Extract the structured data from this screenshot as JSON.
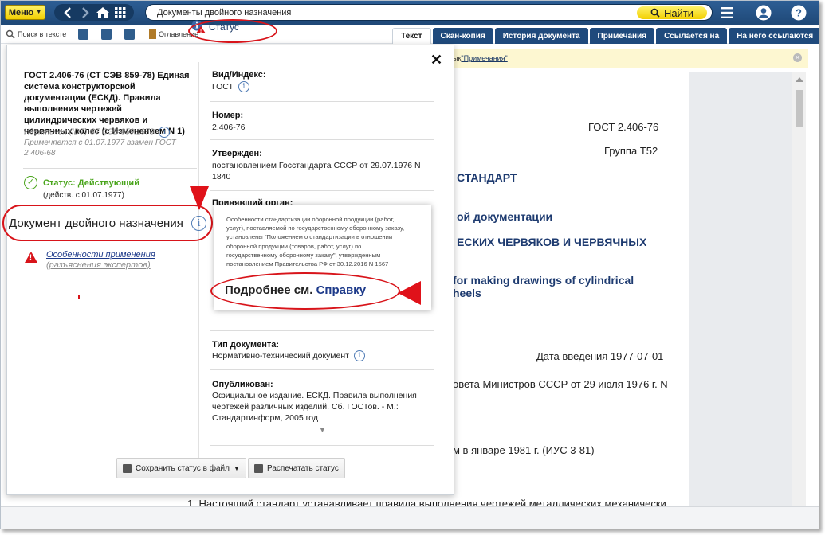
{
  "topbar": {
    "menu_label": "Меню",
    "search_value": "Документы двойного назначения",
    "find_label": "Найти"
  },
  "toolbar": {
    "search_in_text": "Поиск в тексте",
    "contents": "Оглавление",
    "status": "Статус"
  },
  "tabs": [
    {
      "label": "Текст",
      "active": true
    },
    {
      "label": "Скан-копия"
    },
    {
      "label": "История документа"
    },
    {
      "label": "Примечания"
    },
    {
      "label": "Ссылается на"
    },
    {
      "label": "На него ссылаются"
    }
  ],
  "infobar": {
    "prefix": "ык ",
    "link": "\"Примечания\""
  },
  "document": {
    "code": "ГОСТ 2.406-76",
    "group": "Группа Т52",
    "line_standard": "СТАНДАРТ",
    "line_documentation": "ой документации",
    "line_worms": "ЕСКИХ ЧЕРВЯКОВ И ЧЕРВЯЧНЫХ",
    "line_en1": "for making drawings of cylindrical",
    "line_en2": "heels",
    "intro_date": "Дата введения 1977-07-01",
    "council": "овета Министров СССР от 29 июля 1976 г. N",
    "reissue": "м в январе 1981 г. (ИУС 3-81)",
    "clause1": "1. Настоящий стандарт устанавливает правила выполнения чертежей металлических механически"
  },
  "panel": {
    "title": "ГОСТ 2.406-76 (СТ СЭВ 859-78) Единая система конструкторской документации (ЕСКД). Правила выполнения чертежей цилиндрических червяков и червячных колес (с Изменением N 1)",
    "identical": "Идентичен (IDT) СТ СЭВ 859:1978",
    "replaces": "Применяется с 01.07.1977 взамен ГОСТ 2.406-68",
    "status_text": "Статус: Действующий",
    "status_date": "(действ. с 01.07.1977)",
    "dual_purpose": "Документ двойного назначения",
    "features_link": "Особенности применения",
    "features_sub": "(разъяснения экспертов)",
    "fields": {
      "type_index_label": "Вид/Индекс:",
      "type_index_value": "ГОСТ",
      "number_label": "Номер:",
      "number_value": "2.406-76",
      "approved_label": "Утвержден:",
      "approved_value": "постановлением Госстандарта СССР от 29.07.1976 N 1840",
      "accepting_body_label": "Принявший орган:",
      "doc_type_label": "Тип документа:",
      "doc_type_value": "Нормативно-технический документ",
      "published_label": "Опубликован:",
      "published_value": "Официальное издание. ЕСКД. Правила выполнения чертежей различных изделий. Сб. ГОСТов. - М.: Стандартинформ, 2005 год"
    },
    "tooltip": {
      "text": "Особенности стандартизации оборонной продукции (работ, услуг), поставляемой по государственному оборонному заказу, установлены \"Положением о стандартизации в отношении оборонной продукции (товаров, работ, услуг) по государственному оборонному заказу\", утвержденным постановлением Правительства РФ от 30.12.2016 N 1567",
      "more_prefix": "Подробнее см.",
      "more_link": "Справку"
    },
    "buttons": {
      "save": "Сохранить статус в файл",
      "print": "Распечатать статус"
    }
  },
  "colors": {
    "topbar": "#1f4877",
    "accent_yellow": "#f2cf00",
    "active_status": "#4aa51c",
    "annotation_red": "#d8141a"
  }
}
